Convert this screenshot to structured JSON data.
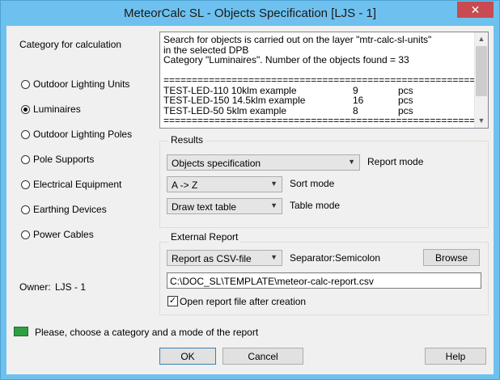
{
  "window": {
    "title": "MeteorCalc SL - Objects Specification   [LJS - 1]",
    "close_glyph": "✕"
  },
  "category": {
    "label": "Category for calculation",
    "options": [
      {
        "label": "Outdoor Lighting Units",
        "checked": false
      },
      {
        "label": "Luminaires",
        "checked": true
      },
      {
        "label": "Outdoor Lighting Poles",
        "checked": false
      },
      {
        "label": "Pole Supports",
        "checked": false
      },
      {
        "label": "Electrical Equipment",
        "checked": false
      },
      {
        "label": "Earthing Devices",
        "checked": false
      },
      {
        "label": "Power Cables",
        "checked": false
      }
    ]
  },
  "owner": {
    "label": "Owner:",
    "value": "LJS - 1"
  },
  "search_output": {
    "lines": [
      "Search for objects is carried out on the layer  \"mtr-calc-sl-units\"",
      "in the selected DPB",
      "Category \"Luminaires\".  Number of the objects found = 33",
      "",
      "========================================================"
    ],
    "rows": [
      {
        "name": "TEST-LED-110 10klm example",
        "count": "9",
        "unit": "pcs"
      },
      {
        "name": "TEST-LED-150 14.5klm example",
        "count": "16",
        "unit": "pcs"
      },
      {
        "name": "TEST-LED-50 5klm example",
        "count": "8",
        "unit": "pcs"
      }
    ],
    "footer": "========================================================"
  },
  "results": {
    "group_label": "Results",
    "report_mode": {
      "value": "Objects specification",
      "label": "Report mode"
    },
    "sort_mode": {
      "value": "A  ->  Z",
      "label": "Sort mode"
    },
    "table_mode": {
      "value": "Draw text table",
      "label": "Table mode"
    }
  },
  "external_report": {
    "group_label": "External Report",
    "format": {
      "value": "Report as CSV-file"
    },
    "separator_label": "Separator:",
    "separator_value": "Semicolon",
    "browse_label": "Browse",
    "path": "C:\\DOC_SL\\TEMPLATE\\meteor-calc-report.csv",
    "open_after": {
      "label": "Open report file after creation",
      "checked": true
    }
  },
  "status": {
    "message": "Please, choose a category and a mode of the report",
    "led_color": "#2ea043"
  },
  "buttons": {
    "ok": "OK",
    "cancel": "Cancel",
    "help": "Help"
  }
}
